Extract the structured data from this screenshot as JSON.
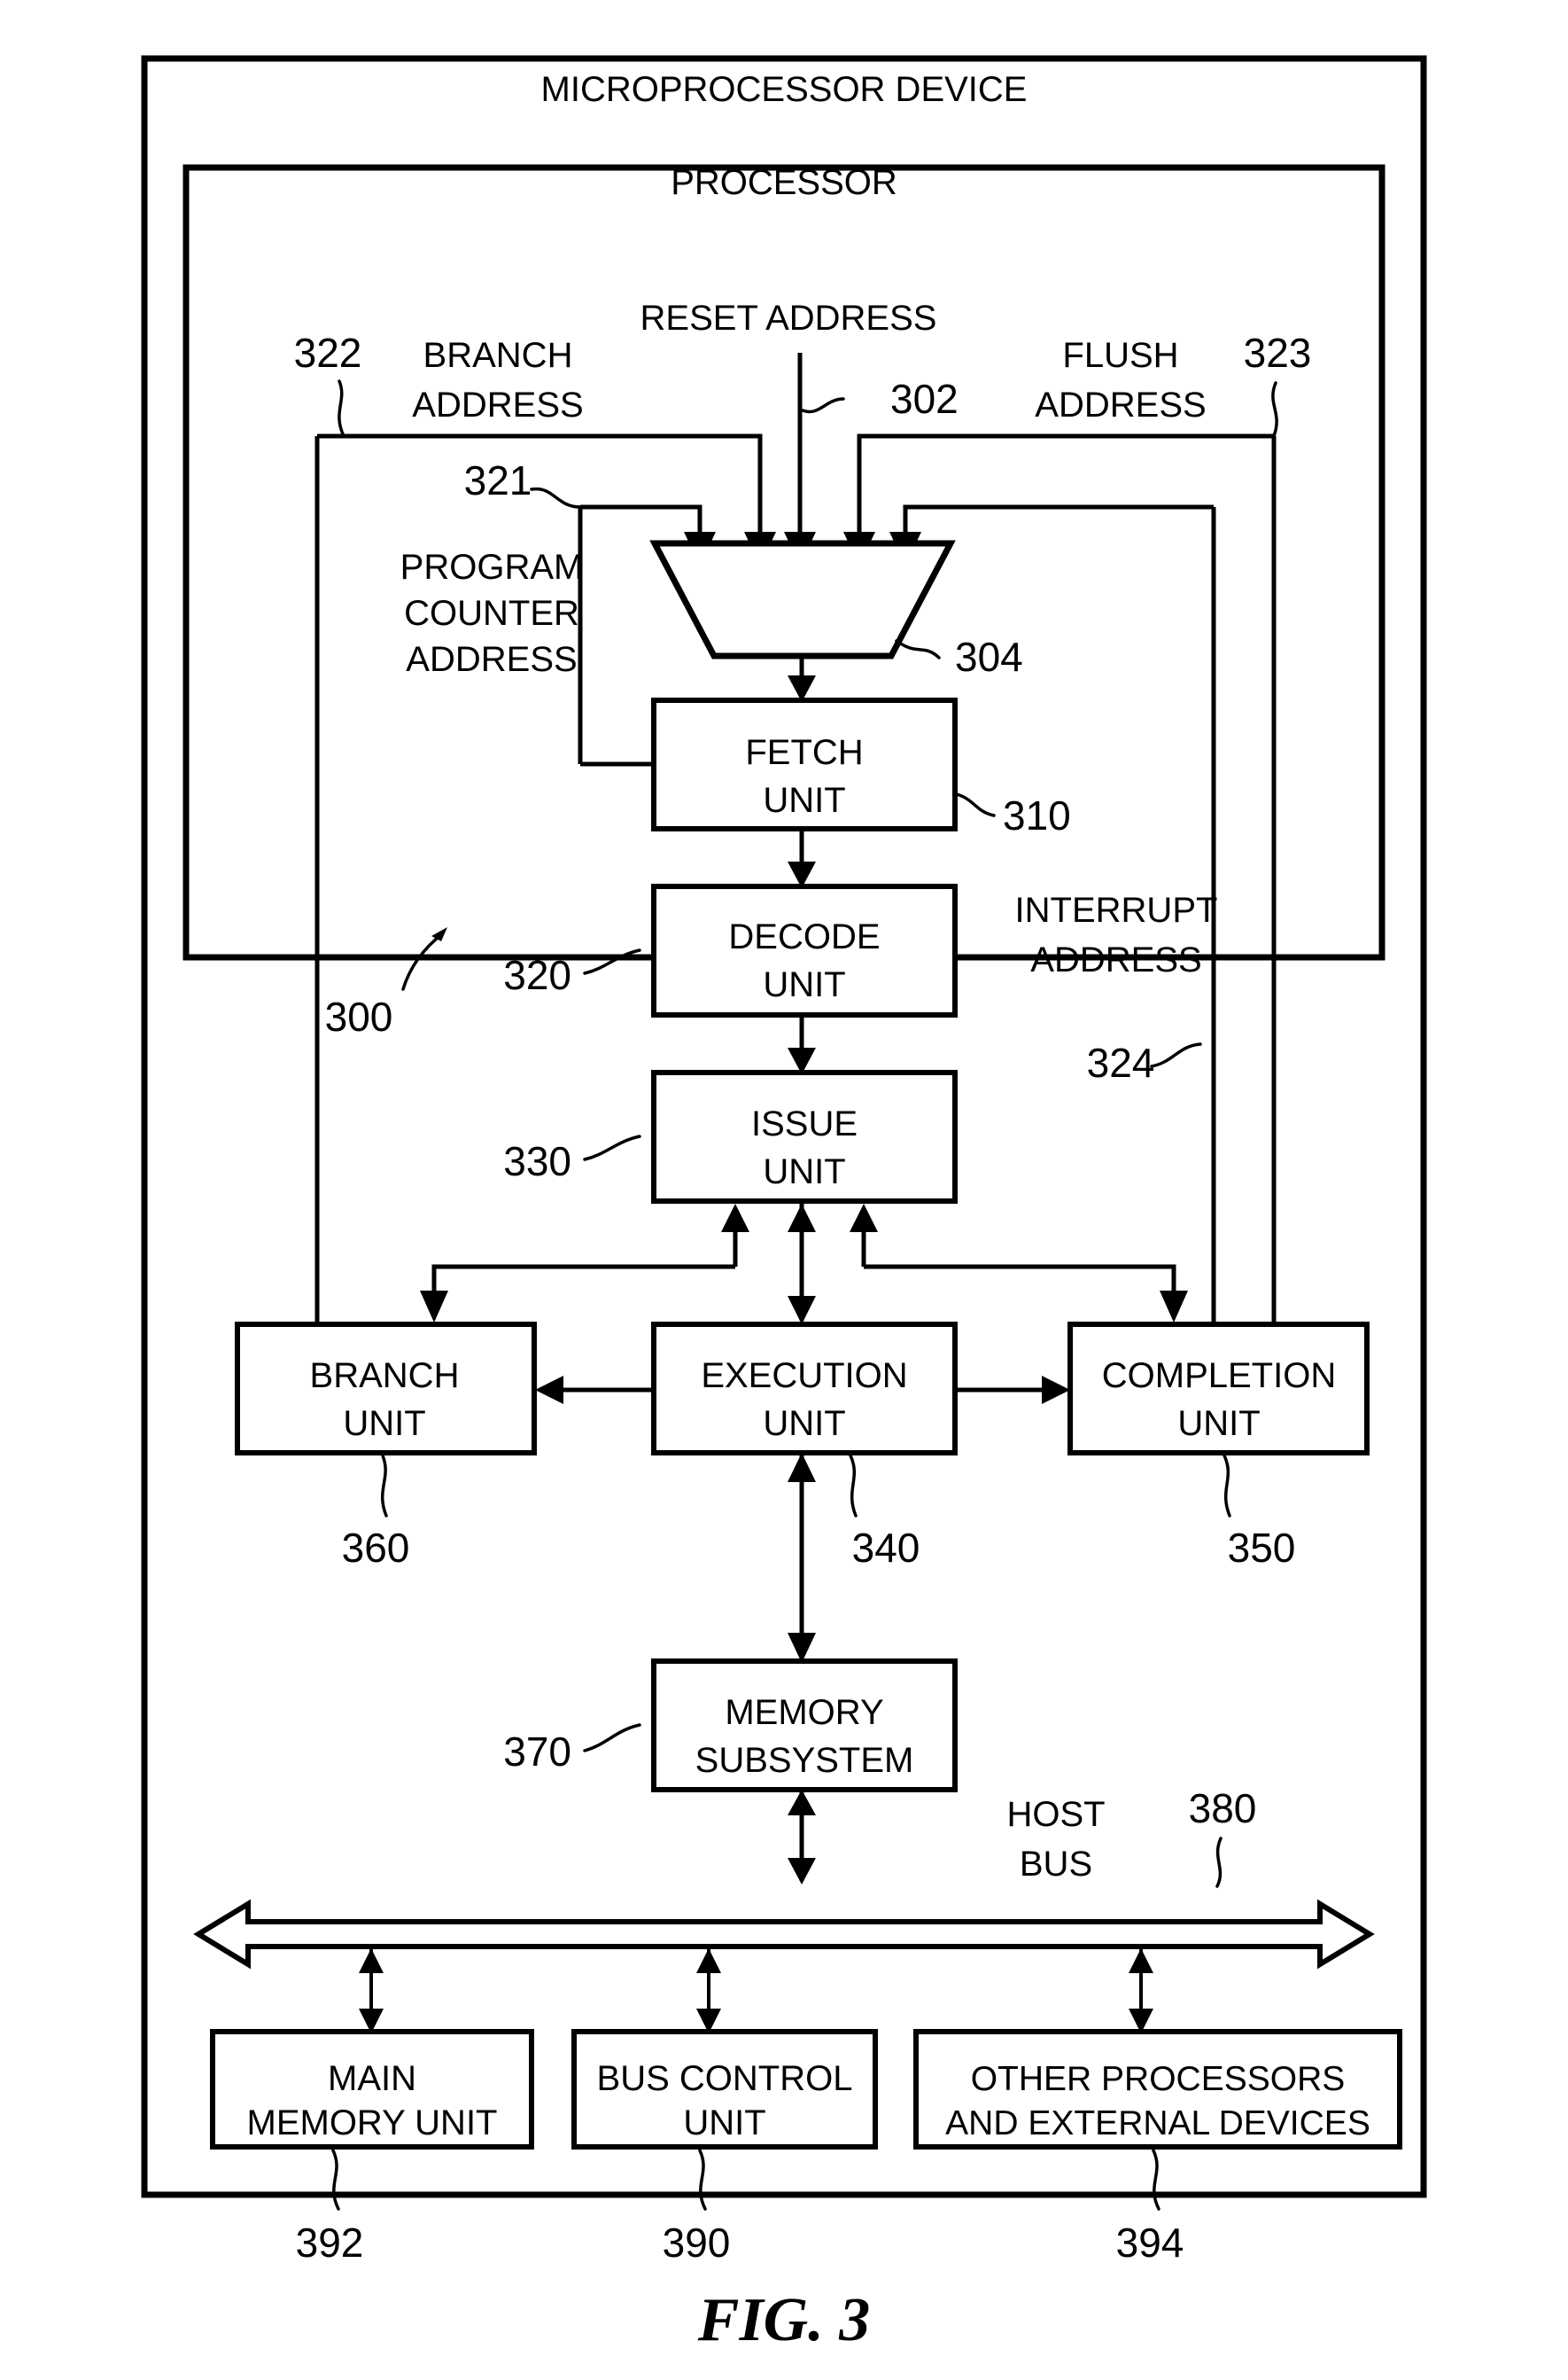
{
  "figure": {
    "caption": "FIG. 3"
  },
  "outer_frame": {
    "title": "MICROPROCESSOR DEVICE"
  },
  "processor_frame": {
    "title": "PROCESSOR",
    "ref": "300"
  },
  "signals": {
    "reset_address": {
      "label": "RESET ADDRESS",
      "ref": "302"
    },
    "branch_address": {
      "label_line1": "BRANCH",
      "label_line2": "ADDRESS",
      "ref": "322"
    },
    "flush_address": {
      "label_line1": "FLUSH",
      "label_line2": "ADDRESS",
      "ref": "323"
    },
    "interrupt_address": {
      "label_line1": "INTERRUPT",
      "label_line2": "ADDRESS",
      "ref": "324"
    },
    "program_counter_address": {
      "label_line1": "PROGRAM",
      "label_line2": "COUNTER",
      "label_line3": "ADDRESS",
      "ref": "321"
    },
    "host_bus": {
      "label_line1": "HOST",
      "label_line2": "BUS",
      "ref": "380"
    }
  },
  "blocks": {
    "mux": {
      "ref": "304"
    },
    "fetch_unit": {
      "line1": "FETCH",
      "line2": "UNIT",
      "ref": "310"
    },
    "decode_unit": {
      "line1": "DECODE",
      "line2": "UNIT",
      "ref": "320"
    },
    "issue_unit": {
      "line1": "ISSUE",
      "line2": "UNIT",
      "ref": "330"
    },
    "branch_unit": {
      "line1": "BRANCH",
      "line2": "UNIT",
      "ref": "360"
    },
    "execution_unit": {
      "line1": "EXECUTION",
      "line2": "UNIT",
      "ref": "340"
    },
    "completion_unit": {
      "line1": "COMPLETION",
      "line2": "UNIT",
      "ref": "350"
    },
    "memory_subsystem": {
      "line1": "MEMORY",
      "line2": "SUBSYSTEM",
      "ref": "370"
    },
    "main_memory_unit": {
      "line1": "MAIN",
      "line2": "MEMORY UNIT",
      "ref": "392"
    },
    "bus_control_unit": {
      "line1": "BUS CONTROL",
      "line2": "UNIT",
      "ref": "390"
    },
    "other_processors": {
      "line1": "OTHER PROCESSORS",
      "line2": "AND EXTERNAL DEVICES",
      "ref": "394"
    }
  },
  "colors": {
    "ink": "#000000",
    "paper": "#ffffff"
  }
}
